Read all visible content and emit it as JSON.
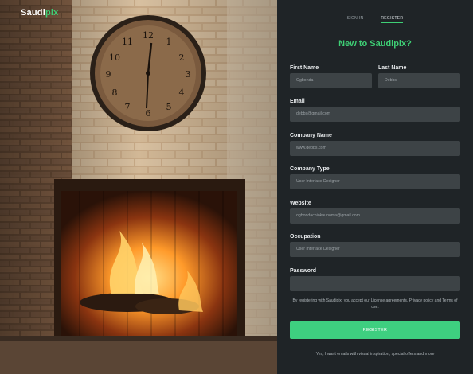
{
  "brand": {
    "name_main": "Saudi",
    "name_accent": "pix"
  },
  "tabs": [
    {
      "label": "SIGN IN",
      "active": false
    },
    {
      "label": "REGISTER",
      "active": true
    }
  ],
  "heading": "New to Saudipix?",
  "form": {
    "first_name": {
      "label": "First Name",
      "value": "Ogbonda"
    },
    "last_name": {
      "label": "Last Name",
      "value": "Debbs"
    },
    "email": {
      "label": "Email",
      "value": "debbs@gmail.com"
    },
    "company_name": {
      "label": "Company Name",
      "value": "www.debbs.com"
    },
    "company_type": {
      "label": "Company Type",
      "value": "User Interface Designer"
    },
    "website": {
      "label": "Website",
      "value": "ogbondachiokaunoma@gmail.com"
    },
    "occupation": {
      "label": "Occupation",
      "value": "User Interface Designer"
    },
    "password": {
      "label": "Password",
      "value": ""
    }
  },
  "terms_text": "By registering with Saudipix, you accept our License agreements, Privacy policy and Terms of use.",
  "register_button": "REGISTER",
  "optin_text": "Yes, I want emails with visual inspiration, special offers and more",
  "colors": {
    "accent": "#3ecf75",
    "panel_bg": "#1f2427",
    "field_bg": "#3d4346"
  }
}
